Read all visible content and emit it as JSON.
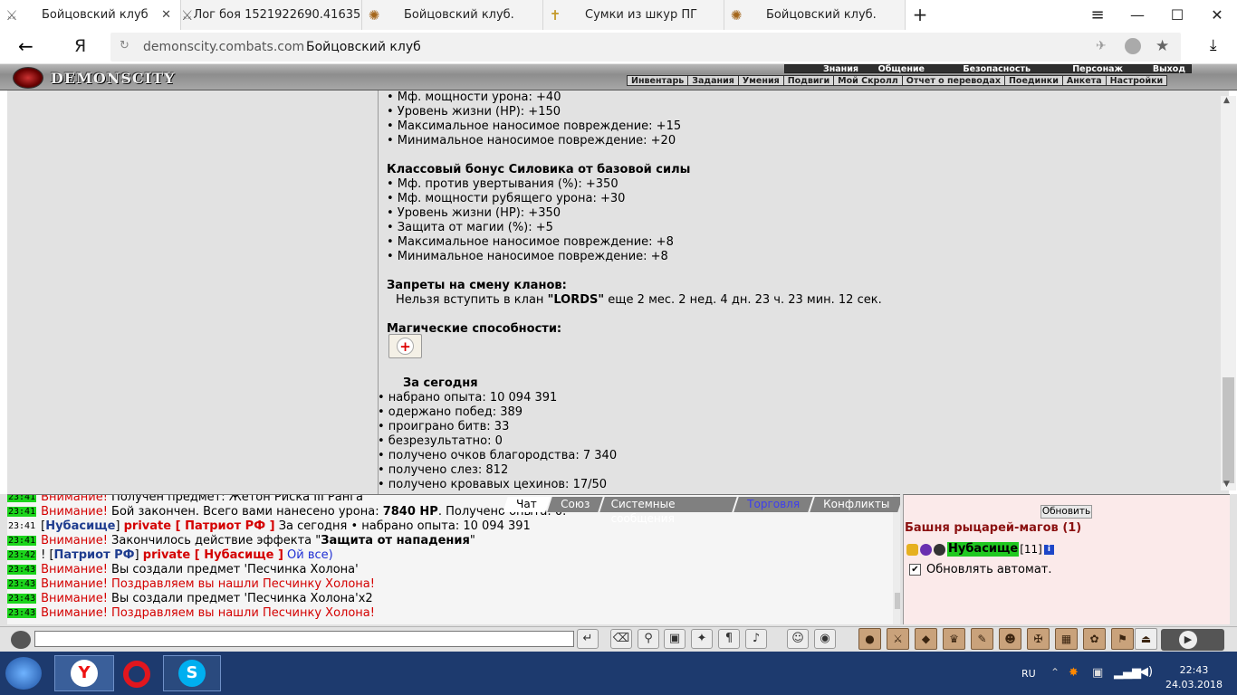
{
  "browser": {
    "tabs": [
      {
        "title": "Бойцовский клуб",
        "icon": "swords-icon",
        "active": true
      },
      {
        "title": "Лог боя 1521922690.41635...",
        "icon": "swords-icon"
      },
      {
        "title": "Бойцовский клуб.",
        "icon": "emblem-icon"
      },
      {
        "title": "Сумки из шкур ПГ",
        "icon": "cross-icon"
      },
      {
        "title": "Бойцовский клуб.",
        "icon": "emblem-icon"
      }
    ],
    "new_tab": "+",
    "menu_icon": "≡",
    "back": "←",
    "yandex_logo": "Я",
    "domain": "demonscity.combats.com",
    "page_title": "Бойцовский клуб"
  },
  "game": {
    "logo": "DEMONSCITY",
    "top_menu": [
      "Знания",
      "Общение",
      "Безопасность",
      "Персонаж",
      "Выход"
    ],
    "sub_menu": [
      "Инвентарь",
      "Задания",
      "Умения",
      "Подвиги",
      "Мой Скролл",
      "Отчет о переводах",
      "Поединки",
      "Анкета",
      "Настройки"
    ]
  },
  "info": {
    "lines1": [
      "• Мф. мощности урона: +40",
      "• Уровень жизни (HP): +150",
      "• Максимальное наносимое повреждение: +15",
      "• Минимальное наносимое повреждение: +20"
    ],
    "class_bonus_title": "Классовый бонус Силовика от базовой силы",
    "lines2": [
      "• Мф. против увертывания (%): +350",
      "• Мф. мощности рубящего урона: +30",
      "• Уровень жизни (HP): +350",
      "• Защита от магии (%): +5",
      "• Максимальное наносимое повреждение: +8",
      "• Минимальное наносимое повреждение: +8"
    ],
    "clan_title": "Запреты на смену кланов:",
    "clan_prefix": "Нельзя вступить в клан ",
    "clan_name": "\"LORDS\"",
    "clan_suffix": " еще 2 мес. 2 нед. 4 дн. 23 ч. 23 мин. 12 сек.",
    "magic_title": "Магические способности:",
    "today_title": "За сегодня",
    "today": [
      "• набрано опыта: 10 094 391",
      "• одержано побед: 389",
      "• проиграно битв: 33",
      "• безрезультатно: 0",
      "• получено очков благородства: 7 340",
      "• получено слез: 812",
      "• получено кровавых цехинов: 17/50"
    ]
  },
  "chat": {
    "tabs": [
      "Чат",
      "Союз",
      "Системные сообщения",
      "Торговля",
      "Конфликты"
    ],
    "attention": "Внимание!",
    "l1_text": " Получен предмет: Жетон Риска III Ранга",
    "l2_text": " Бой закончен. Всего вами нанесено урона: ",
    "l2_hp": "7840 HP",
    "l2_tail": ". Получено опыта: 0.",
    "l3_nick": "Нубасище",
    "l3_priv": "private [ Патриот РФ ]",
    "l3_text": " За сегодня • набрано опыта: 10 094 391",
    "l4_text": " Закончилось действие эффекта \"",
    "l4_effect": "Защита от нападения",
    "l4_end": "\"",
    "l5_pre": "! [",
    "l5_nick": "Патриот РФ",
    "l5_mid": "] ",
    "l5_priv": "private [ Нубасище ]",
    "l5_text": " Ой все)",
    "l6_text": " Вы создали предмет 'Песчинка Холона'",
    "l7_text": " Поздравляем вы нашли Песчинку Холона!",
    "l8_text": " Вы создали предмет 'Песчинка Холона'x2",
    "l9_text": " Поздравляем вы нашли Песчинку Холона!",
    "times": [
      "23:41",
      "23:41",
      "23:41",
      "23:41",
      "23:42",
      "23:43",
      "23:43",
      "23:43",
      "23:43"
    ]
  },
  "users": {
    "refresh": "Обновить",
    "room": "Башня рыцарей-магов (1)",
    "user_name": "Нубасище",
    "user_level": "[11]",
    "info_icon": "i",
    "auto_refresh": "Обновлять автомат."
  },
  "taskbar": {
    "lang": "RU",
    "time": "22:43",
    "date": "24.03.2018"
  }
}
